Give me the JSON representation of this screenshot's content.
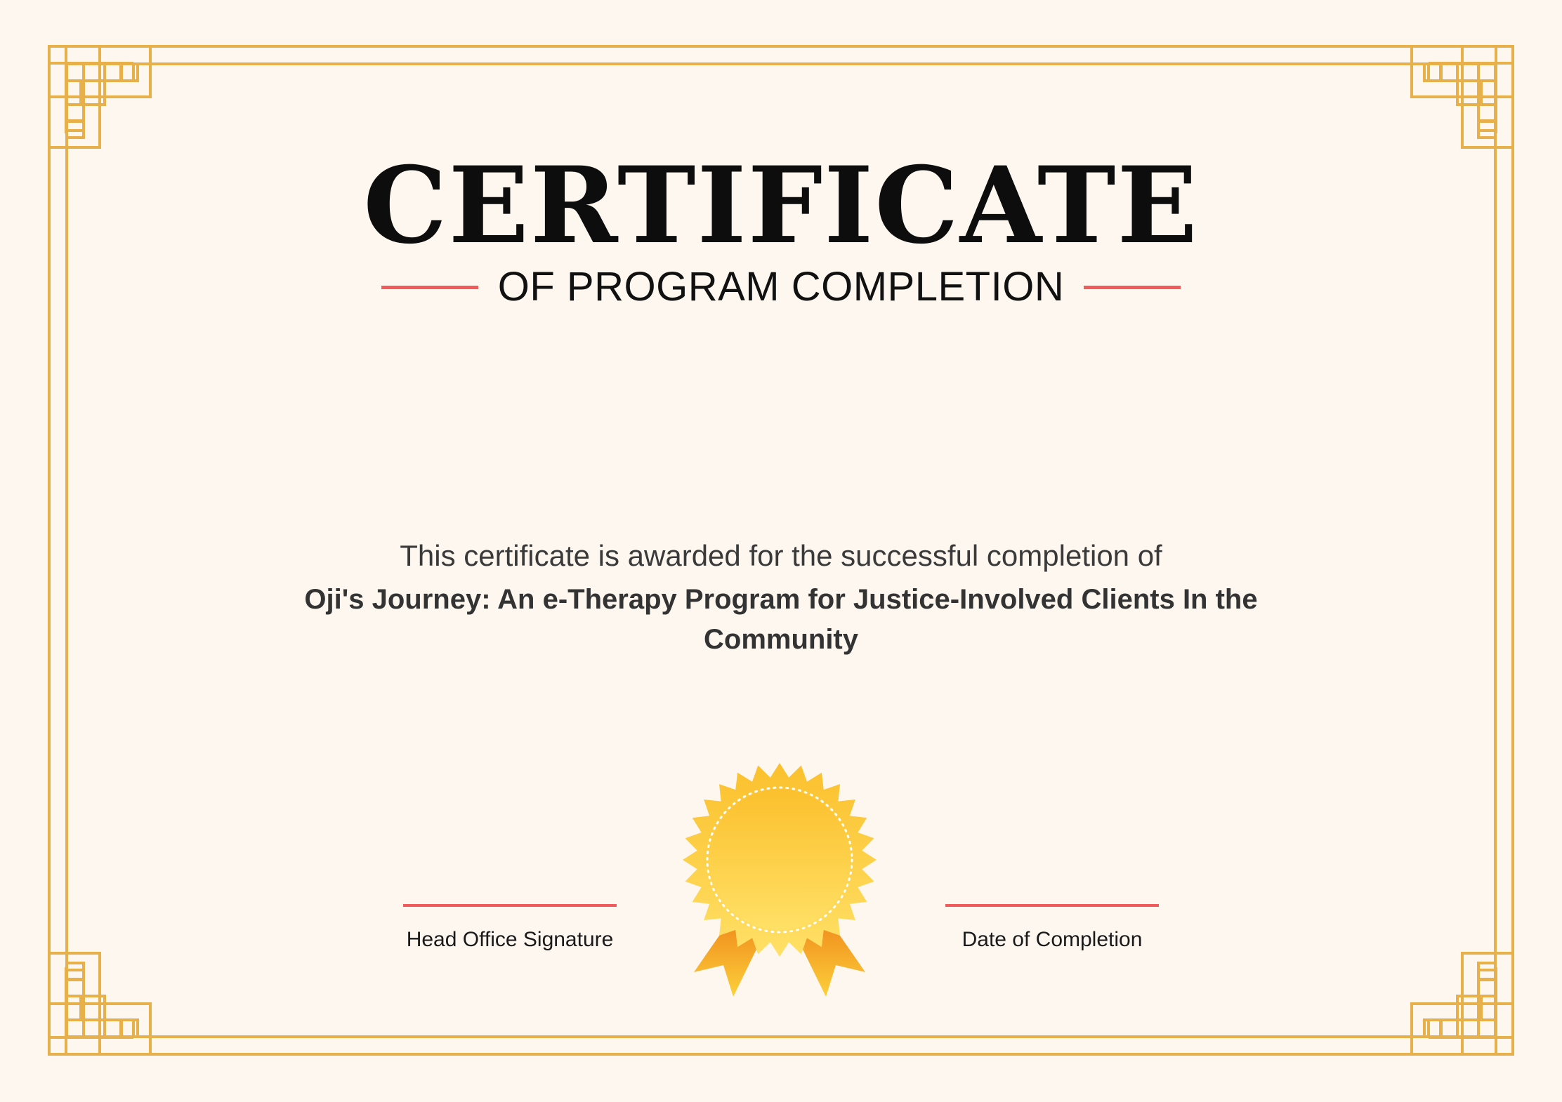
{
  "certificate": {
    "title": "CERTIFICATE",
    "subtitle": "OF PROGRAM COMPLETION",
    "award_text": "This certificate is awarded for the successful completion of",
    "program_name": "Oji's Journey: An e-Therapy Program for Justice-Involved Clients In the Community",
    "signature_label": "Head Office Signature",
    "date_label": "Date of Completion"
  },
  "colors": {
    "background": "#fdf7f0",
    "border_gold": "#e8b04a",
    "accent_red": "#f15b5b",
    "seal_gold": "#fbc531"
  },
  "icons": {
    "seal": "award-seal-icon",
    "corners": "fret-corner-ornament"
  }
}
